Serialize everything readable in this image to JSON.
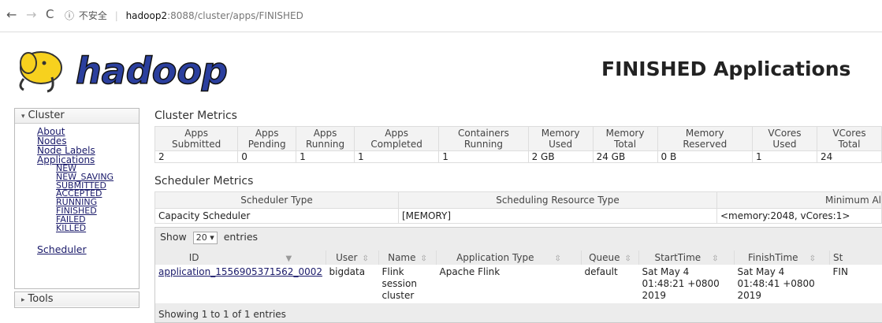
{
  "browser": {
    "nav_back": "←",
    "nav_forward": "→",
    "nav_reload": "C",
    "security_icon": "ⓘ",
    "security_text": "不安全",
    "url_host": "hadoop2",
    "url_path": ":8088/cluster/apps/FINISHED"
  },
  "header": {
    "logo_text": "hadoop",
    "title": "FINISHED Applications"
  },
  "sidebar": {
    "cluster_label": "Cluster",
    "links": [
      "About",
      "Nodes",
      "Node Labels",
      "Applications"
    ],
    "sub_links": [
      "NEW",
      "NEW_SAVING",
      "SUBMITTED",
      "ACCEPTED",
      "RUNNING",
      "FINISHED",
      "FAILED",
      "KILLED"
    ],
    "scheduler_link": "Scheduler",
    "tools_label": "Tools"
  },
  "cluster_metrics": {
    "title": "Cluster Metrics",
    "headers": [
      [
        "Apps",
        "Submitted"
      ],
      [
        "Apps",
        "Pending"
      ],
      [
        "Apps",
        "Running"
      ],
      [
        "Apps",
        "Completed"
      ],
      [
        "Containers",
        "Running"
      ],
      [
        "Memory",
        "Used"
      ],
      [
        "Memory",
        "Total"
      ],
      [
        "Memory",
        "Reserved"
      ],
      [
        "VCores",
        "Used"
      ],
      [
        "VCores",
        "Total"
      ]
    ],
    "values": [
      "2",
      "0",
      "1",
      "1",
      "1",
      "2 GB",
      "24 GB",
      "0 B",
      "1",
      "24"
    ]
  },
  "scheduler_metrics": {
    "title": "Scheduler Metrics",
    "headers": [
      "Scheduler Type",
      "Scheduling Resource Type",
      "Minimum Al"
    ],
    "values": [
      "Capacity Scheduler",
      "[MEMORY]",
      "<memory:2048, vCores:1>"
    ]
  },
  "apps": {
    "show_label": "Show",
    "show_value": "20",
    "entries_label": "entries",
    "headers": [
      "ID",
      "User",
      "Name",
      "Application Type",
      "Queue",
      "StartTime",
      "FinishTime",
      "St"
    ],
    "rows": [
      {
        "id": "application_1556905371562_0002",
        "user": "bigdata",
        "name": "Flink session cluster",
        "type": "Apache Flink",
        "queue": "default",
        "start": "Sat May 4 01:48:21 +0800 2019",
        "finish": "Sat May 4 01:48:41 +0800 2019",
        "state": "FIN"
      }
    ],
    "footer": "Showing 1 to 1 of 1 entries"
  }
}
